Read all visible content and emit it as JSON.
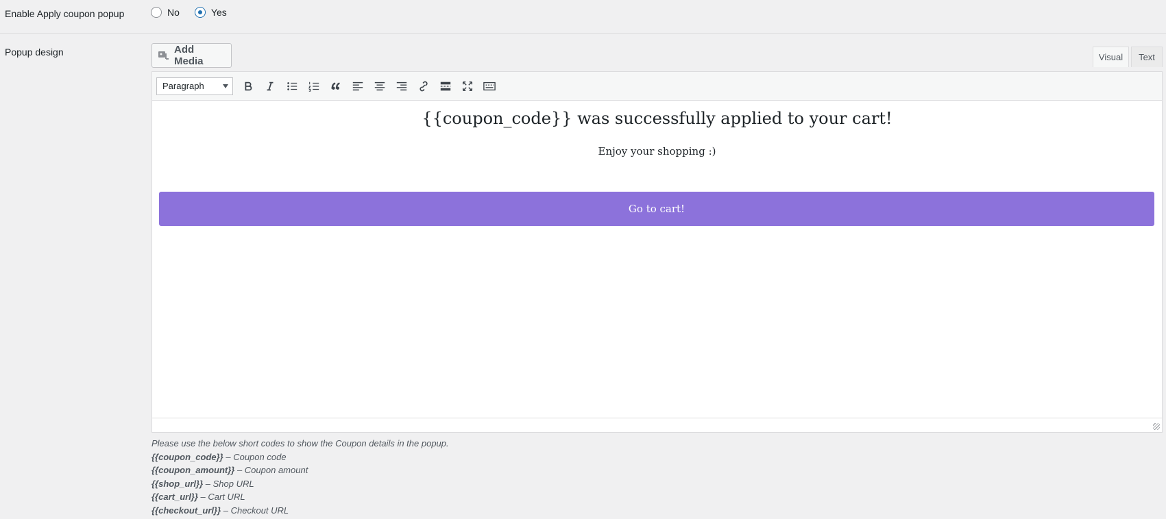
{
  "enable_popup": {
    "label": "Enable Apply coupon popup",
    "options": [
      {
        "label": "No",
        "checked": false
      },
      {
        "label": "Yes",
        "checked": true
      }
    ]
  },
  "popup_design": {
    "label": "Popup design",
    "add_media_label": "Add Media",
    "tabs": {
      "visual": "Visual",
      "text": "Text"
    },
    "format_value": "Paragraph",
    "toolbar_icons": [
      "bold-icon",
      "italic-icon",
      "bullet-list-icon",
      "numbered-list-icon",
      "blockquote-icon",
      "align-left-icon",
      "align-center-icon",
      "align-right-icon",
      "link-icon",
      "read-more-icon",
      "fullscreen-icon",
      "toolbar-toggle-icon"
    ],
    "content": {
      "heading": "{{coupon_code}} was successfully applied to your cart!",
      "subtext": "Enjoy your shopping :)",
      "button": "Go to cart!",
      "button_color": "#8c72db"
    }
  },
  "help": {
    "intro": "Please use the below short codes to show the Coupon details in the popup.",
    "codes": [
      {
        "code": "{{coupon_code}}",
        "desc": " – Coupon code"
      },
      {
        "code": "{{coupon_amount}}",
        "desc": " – Coupon amount"
      },
      {
        "code": "{{shop_url}}",
        "desc": " – Shop URL"
      },
      {
        "code": "{{cart_url}}",
        "desc": " – Cart URL"
      },
      {
        "code": "{{checkout_url}}",
        "desc": " – Checkout URL"
      }
    ]
  }
}
